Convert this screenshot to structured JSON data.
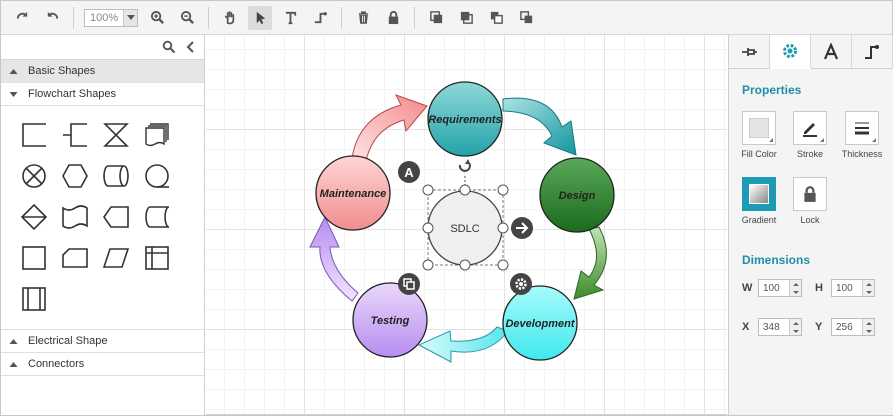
{
  "toolbar": {
    "zoom_value": "100%",
    "buttons": [
      "redo-icon",
      "undo-icon",
      "zoom-in-icon",
      "zoom-out-icon",
      "pan-icon",
      "select-icon",
      "text-icon",
      "connector-icon",
      "delete-icon",
      "lock-icon",
      "send-to-back-icon",
      "bring-to-front-icon",
      "send-backward-icon",
      "bring-forward-icon"
    ]
  },
  "palette": {
    "search_placeholder": "",
    "sections": [
      {
        "label": "Basic Shapes",
        "expanded": false
      },
      {
        "label": "Flowchart Shapes",
        "expanded": true
      },
      {
        "label": "Electrical Shape",
        "expanded": false
      },
      {
        "label": "Connectors",
        "expanded": false
      }
    ]
  },
  "diagram": {
    "nodes": {
      "requirements": "Requirements",
      "design": "Design",
      "development": "Development",
      "testing": "Testing",
      "maintenance": "Maintenance",
      "center": "SDLC"
    }
  },
  "properties": {
    "title": "Properties",
    "fill_label": "Fill Color",
    "stroke_label": "Stroke",
    "thickness_label": "Thickness",
    "gradient_label": "Gradient",
    "lock_label": "Lock"
  },
  "dimensions": {
    "title": "Dimensions",
    "w_label": "W",
    "w_value": "100",
    "h_label": "H",
    "h_value": "100",
    "x_label": "X",
    "x_value": "348",
    "y_label": "Y",
    "y_value": "256"
  },
  "colors": {
    "accent": "#1e9bb4"
  }
}
